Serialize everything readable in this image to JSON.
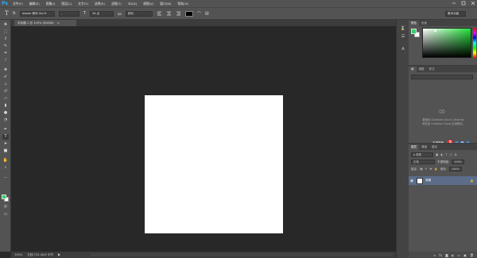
{
  "app": {
    "logo": "Ps"
  },
  "menu": [
    "文件(F)",
    "编辑(E)",
    "图像(I)",
    "图层(L)",
    "文字(Y)",
    "选择(S)",
    "滤镜(T)",
    "3D(D)",
    "视图(V)",
    "窗口(W)",
    "帮助(H)"
  ],
  "options": {
    "font_family": "Adobe 黑体 Std R",
    "font_style": "-",
    "font_size": "36 点",
    "antialias": "锐利",
    "workspace": "基本功能"
  },
  "document": {
    "tab_label": "未标题-1 @ 100% (RGB/8)",
    "tab_close": "×",
    "canvas_color": "#ffffff"
  },
  "status": {
    "zoom": "100%",
    "doc_size": "文档:732.4K/0 字节"
  },
  "color_panel": {
    "tabs": [
      "颜色",
      "色板"
    ],
    "fg_color": "#2fd36c",
    "bg_color": "#ffffff"
  },
  "libraries": {
    "tabs": [
      "库",
      "调整",
      "样式"
    ],
    "message_line1": "要使用 Creative Cloud Libraries,",
    "message_line2": "请安装 Creative Cloud 应用程序。",
    "ime_label": "五鼠新版",
    "ime_logo": "S"
  },
  "layers": {
    "tabs": [
      "图层",
      "通道",
      "路径"
    ],
    "kind_filter": "ρ 类型",
    "blend_mode": "正常",
    "opacity_label": "不透明度:",
    "opacity_value": "100%",
    "lock_label": "锁定:",
    "fill_label": "填充:",
    "fill_value": "100%",
    "items": [
      {
        "name": "背景"
      }
    ]
  }
}
